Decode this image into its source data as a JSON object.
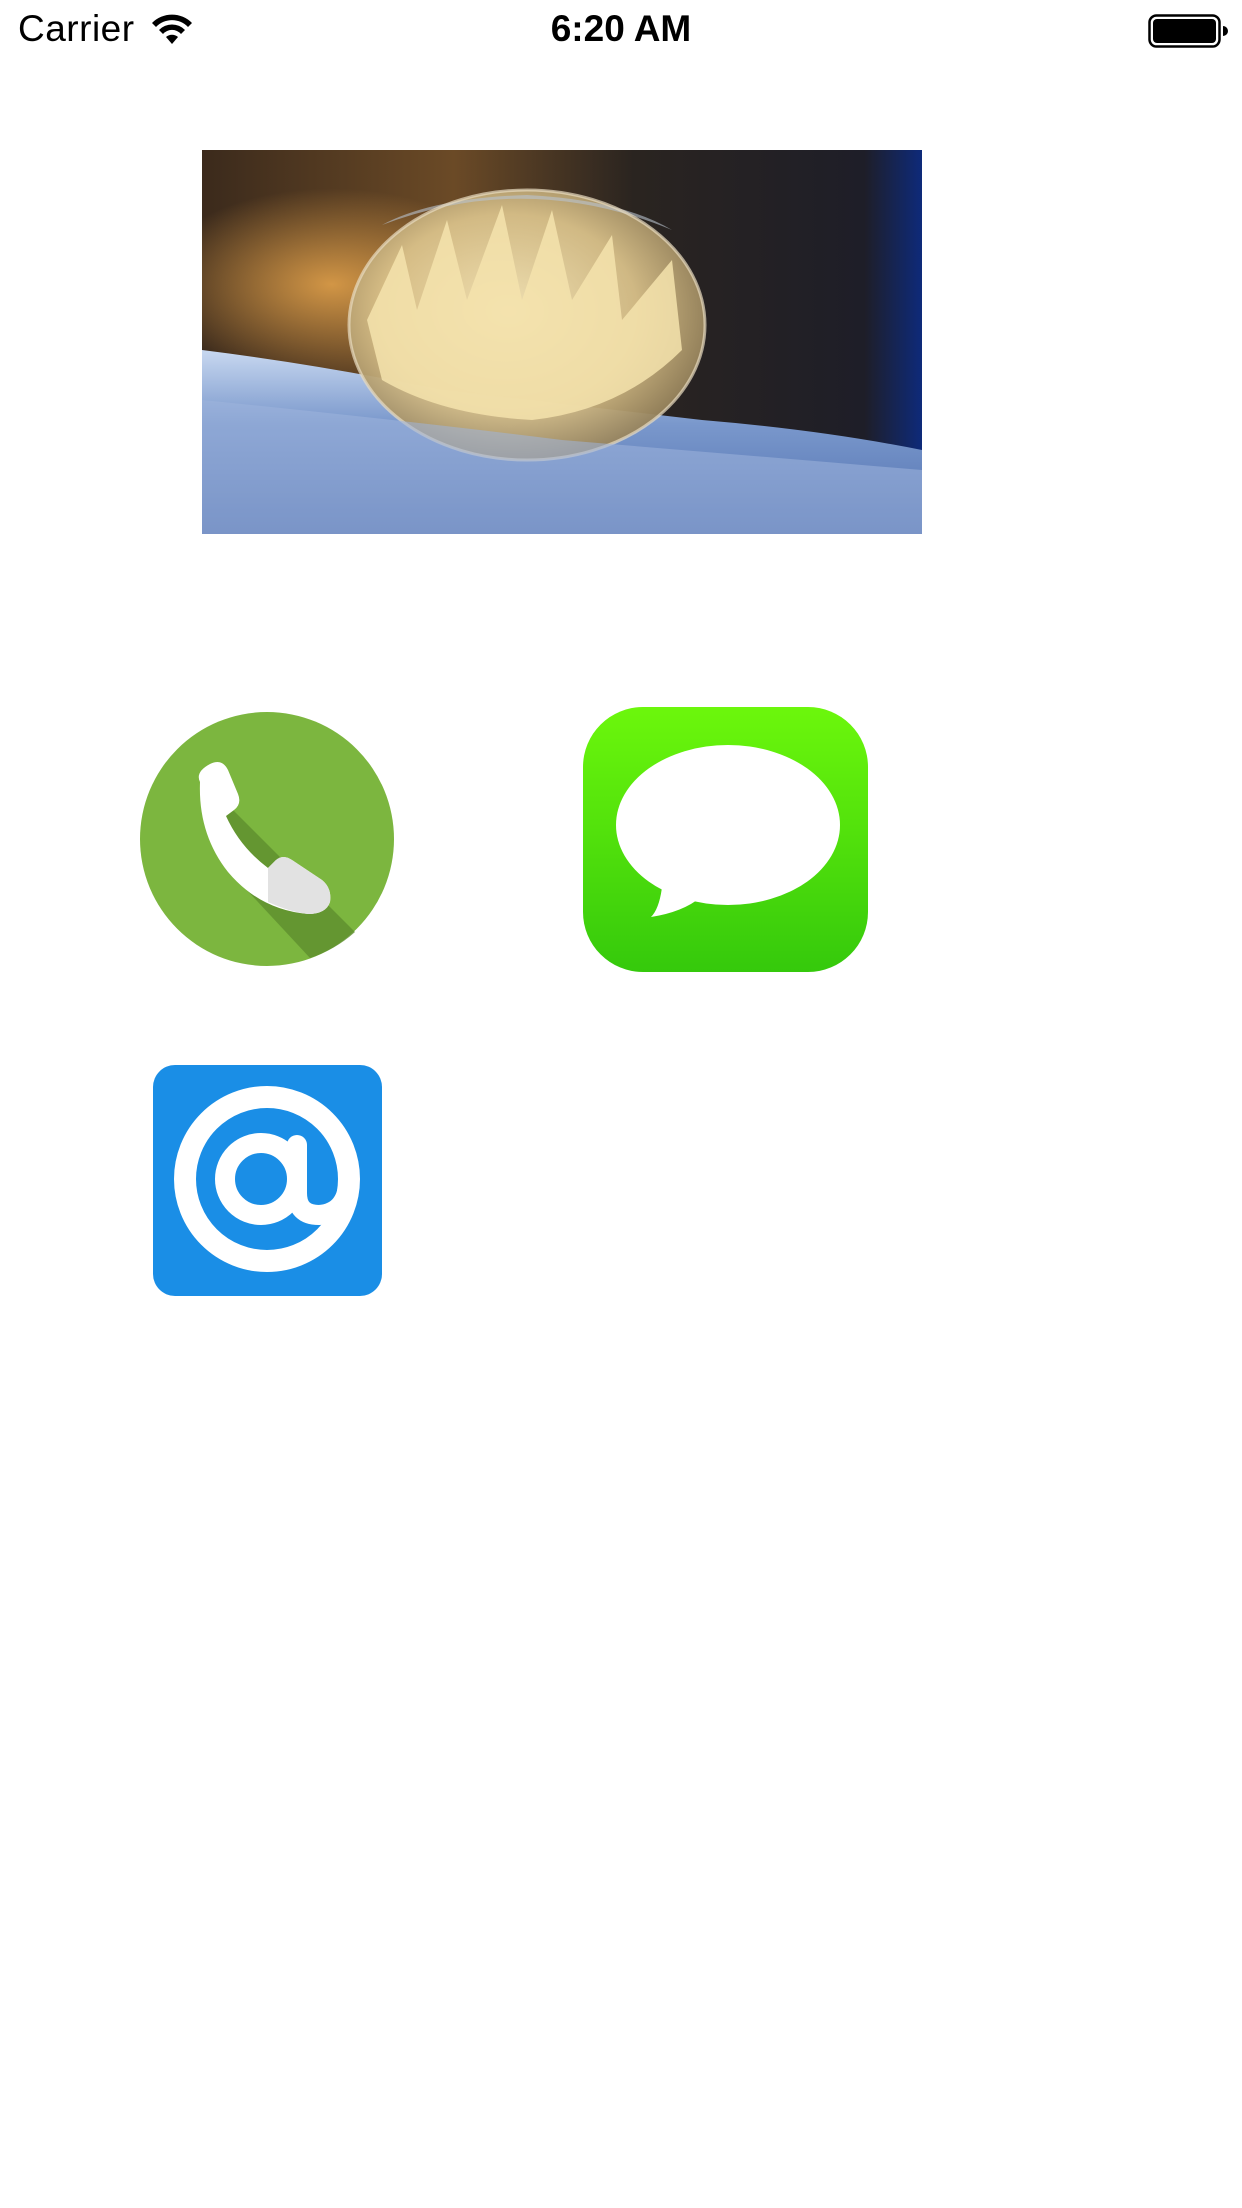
{
  "status_bar": {
    "carrier": "Carrier",
    "time": "6:20 AM",
    "wifi_icon": "wifi-icon",
    "battery_icon": "battery-full-icon"
  },
  "hero": {
    "icon": "frozen-bubble-photo"
  },
  "apps": [
    {
      "icon": "phone-icon",
      "color": "#7cb63f"
    },
    {
      "icon": "message-icon",
      "color": "#4cd10f"
    },
    {
      "icon": "at-sign-icon",
      "color": "#1a8ee6"
    }
  ]
}
